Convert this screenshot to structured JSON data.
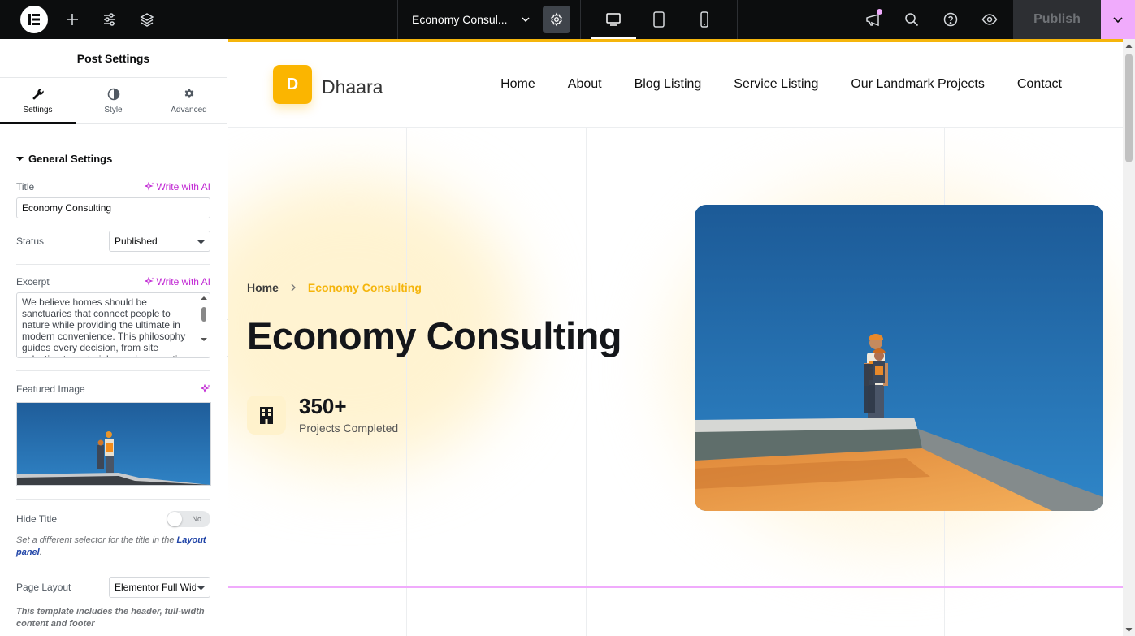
{
  "topbar": {
    "document_title": "Economy Consul...",
    "publish_label": "Publish",
    "colors": {
      "background": "#0c0d0e",
      "accent_pink": "#f0abfc"
    }
  },
  "panel": {
    "header": "Post Settings",
    "tabs": [
      {
        "label": "Settings",
        "icon": "wrench-icon",
        "active": true
      },
      {
        "label": "Style",
        "icon": "half-circle-icon",
        "active": false
      },
      {
        "label": "Advanced",
        "icon": "gear-icon",
        "active": false
      }
    ],
    "section_title": "General Settings",
    "title_label": "Title",
    "write_ai": "Write with AI",
    "title_value": "Economy Consulting",
    "status_label": "Status",
    "status_value": "Published",
    "excerpt_label": "Excerpt",
    "excerpt_value": "We believe homes should be sanctuaries that connect people to nature while providing the ultimate in modern convenience. This philosophy guides every decision, from site selection to material sourcing, creating",
    "featured_label": "Featured Image",
    "hide_title_label": "Hide Title",
    "hide_title_toggle": "No",
    "note_prefix": "Set a different selector for the title in the",
    "note_link": "Layout panel",
    "note_suffix": ".",
    "page_layout_label": "Page Layout",
    "page_layout_value": "Elementor Full Width",
    "template_note": "This template includes the header, full-width content and footer"
  },
  "site": {
    "logo_letter": "D",
    "site_name": "Dhaara",
    "nav": [
      "Home",
      "About",
      "Blog Listing",
      "Service Listing",
      "Our Landmark Projects",
      "Contact"
    ],
    "breadcrumb_home": "Home",
    "breadcrumb_current": "Economy Consulting",
    "hero_title": "Economy Consulting",
    "stat_number": "350+",
    "stat_label": "Projects Completed",
    "colors": {
      "accent": "#f5b50c",
      "logo_bg": "#fbb500"
    }
  }
}
